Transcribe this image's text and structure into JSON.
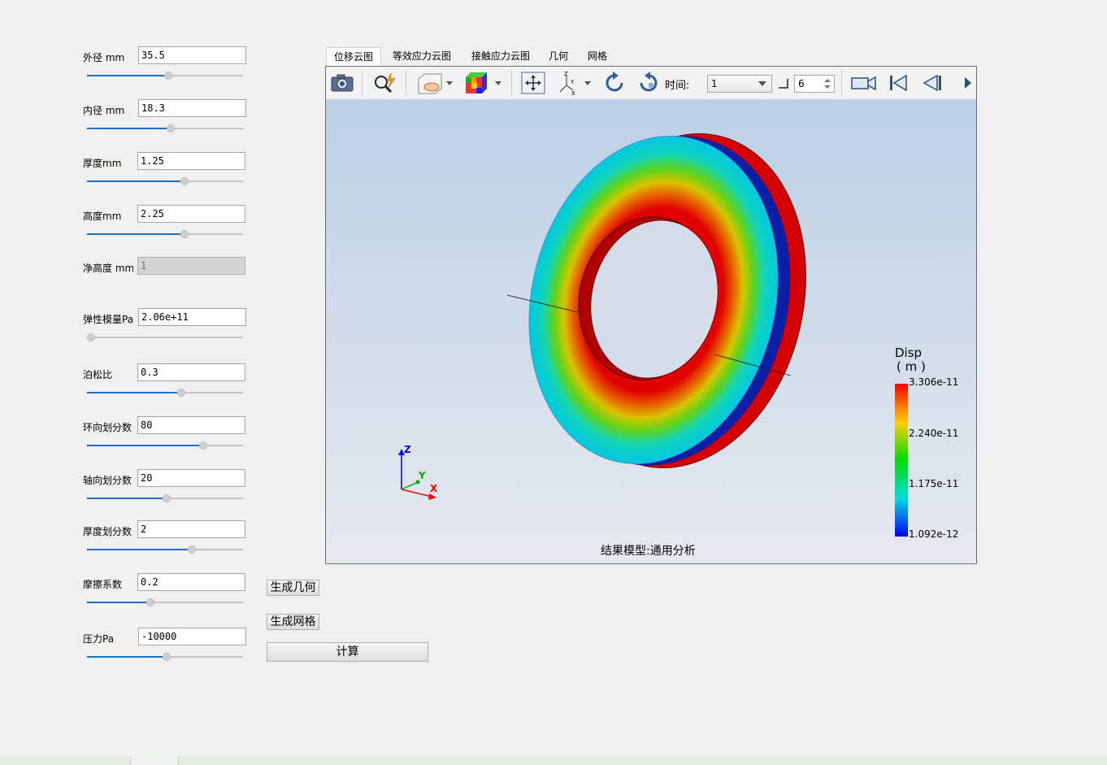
{
  "params": [
    {
      "label": "外径 mm",
      "value": "35.5",
      "fill": 0.52
    },
    {
      "label": "内径 mm",
      "value": "18.3",
      "fill": 0.54
    },
    {
      "label": "厚度mm",
      "value": "1.25",
      "fill": 0.63
    },
    {
      "label": "高度mm",
      "value": "2.25",
      "fill": 0.63
    },
    {
      "label": "净高度 mm",
      "value": "1",
      "disabled": true
    },
    {
      "label": "弹性模量Pa",
      "value": "2.06e+11",
      "fill": 0.0
    },
    {
      "label": "泊松比",
      "value": "0.3",
      "fill": 0.61
    },
    {
      "label": "环向划分数",
      "value": "80",
      "fill": 0.76
    },
    {
      "label": "轴向划分数",
      "value": "20",
      "fill": 0.51
    },
    {
      "label": "厚度划分数",
      "value": "2",
      "fill": 0.68
    },
    {
      "label": "摩擦系数",
      "value": "0.2",
      "fill": 0.4
    },
    {
      "label": "压力Pa",
      "value": "-10000",
      "fill": 0.51
    }
  ],
  "buttons": {
    "gen_geometry": "生成几何",
    "gen_mesh": "生成网格",
    "compute": "计算"
  },
  "tabs": [
    "位移云图",
    "等效应力云图",
    "接触应力云图",
    "几何",
    "网格"
  ],
  "toolbar": {
    "time_label": "时间:",
    "time_value": "1",
    "step_value": "6"
  },
  "viewer": {
    "caption": "结果模型:通用分析",
    "legend_title": "Disp",
    "legend_unit": "( m )",
    "legend_values": [
      "3.306e-11",
      "2.240e-11",
      "1.175e-11",
      "1.092e-12"
    ],
    "axes": {
      "z": "Z",
      "y": "Y",
      "x": "X"
    }
  },
  "colors": {
    "slider_fill": "#1e6fc7",
    "background": "#f0f0f0"
  }
}
